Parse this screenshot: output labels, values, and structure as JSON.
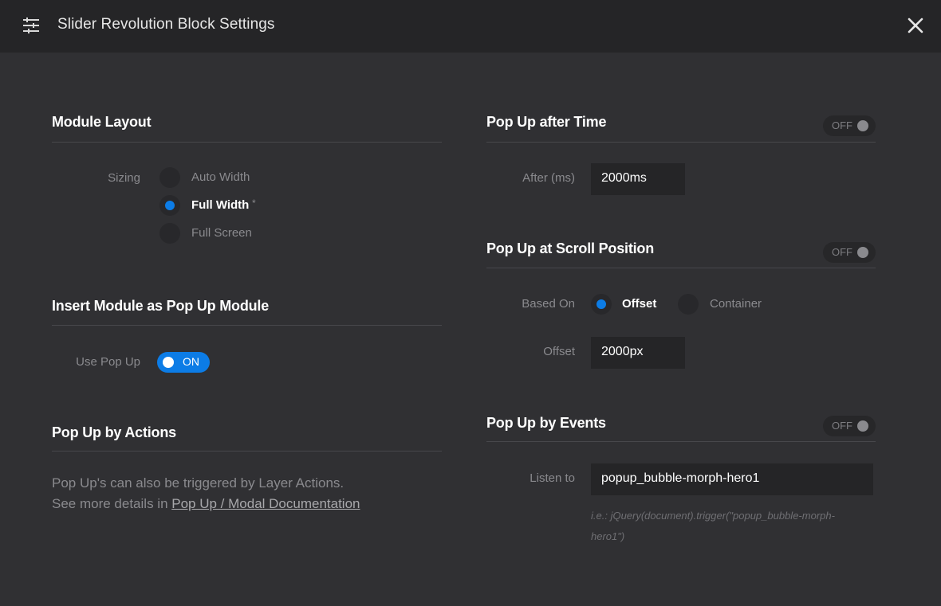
{
  "header": {
    "title": "Slider Revolution Block Settings",
    "icon": "settings-sliders-icon",
    "close_icon": "close-icon"
  },
  "colors": {
    "accent": "#0c7ce6",
    "background": "#303033",
    "header_background": "#252527"
  },
  "module_layout": {
    "title": "Module Layout",
    "sizing_label": "Sizing",
    "options": [
      {
        "label": "Auto Width",
        "selected": false
      },
      {
        "label": "Full Width",
        "selected": true,
        "marker": "*"
      },
      {
        "label": "Full Screen",
        "selected": false
      }
    ]
  },
  "insert_popup": {
    "title": "Insert Module as Pop Up Module",
    "use_popup_label": "Use Pop Up",
    "toggle_text": "ON",
    "enabled": true
  },
  "popup_actions": {
    "title": "Pop Up by Actions",
    "text_line1": "Pop Up's can also be triggered by Layer Actions.",
    "text_line2_prefix": "See more details in ",
    "link_text": "Pop Up / Modal Documentation"
  },
  "popup_time": {
    "title": "Pop Up after Time",
    "toggle_text": "OFF",
    "enabled": false,
    "after_label": "After (ms)",
    "after_value": "2000ms"
  },
  "popup_scroll": {
    "title": "Pop Up at Scroll Position",
    "toggle_text": "OFF",
    "enabled": false,
    "based_on_label": "Based On",
    "options": [
      {
        "label": "Offset",
        "selected": true
      },
      {
        "label": "Container",
        "selected": false
      }
    ],
    "offset_label": "Offset",
    "offset_value": "2000px"
  },
  "popup_events": {
    "title": "Pop Up by Events",
    "toggle_text": "OFF",
    "enabled": false,
    "listen_label": "Listen to",
    "listen_value": "popup_bubble-morph-hero1",
    "hint_line1": "i.e.: jQuery(document).trigger(\"popup_bubble-morph-",
    "hint_line2": "hero1\")"
  }
}
